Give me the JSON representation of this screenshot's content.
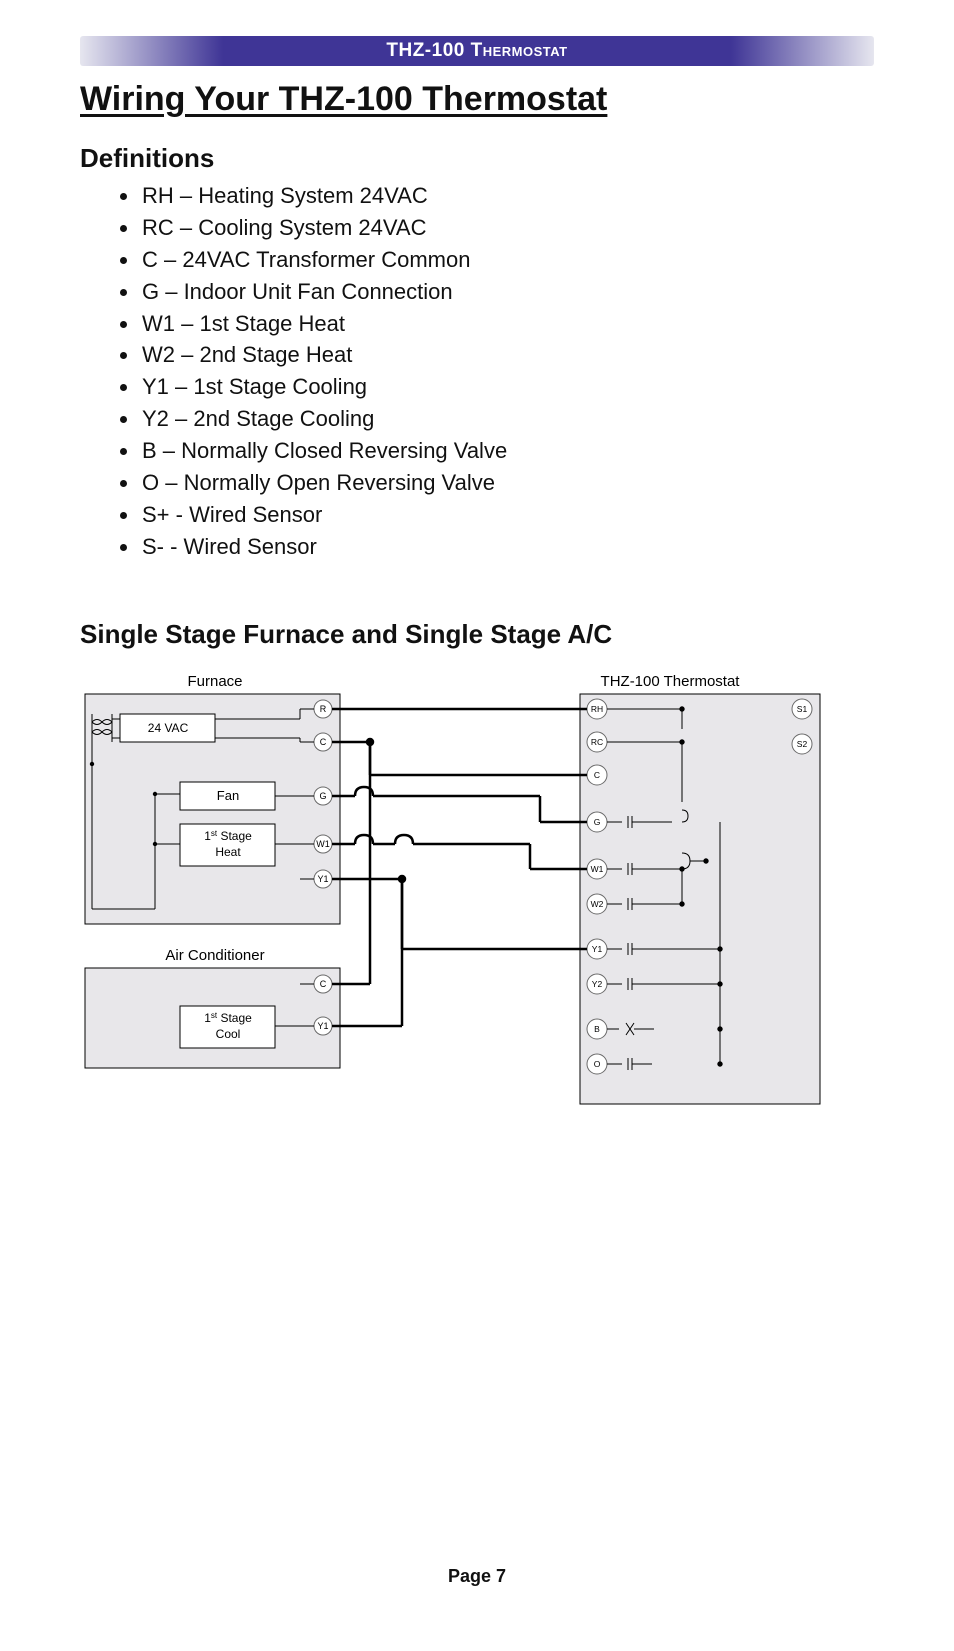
{
  "header": {
    "title": "THZ-100 Thermostat"
  },
  "main": {
    "title": "Wiring Your THZ-100 Thermostat",
    "definitions_heading": "Definitions",
    "definitions": [
      "RH – Heating System 24VAC",
      "RC – Cooling System 24VAC",
      "C – 24VAC Transformer Common",
      "G – Indoor Unit Fan Connection",
      "W1 – 1st Stage Heat",
      "W2 – 2nd Stage Heat",
      "Y1 – 1st Stage Cooling",
      "Y2 – 2nd Stage Cooling",
      "B – Normally Closed Reversing Valve",
      "O – Normally Open Reversing Valve",
      "S+ - Wired Sensor",
      "S- - Wired Sensor"
    ],
    "diagram_title": "Single Stage Furnace and Single Stage A/C",
    "diagram": {
      "left_top_label": "Furnace",
      "left_bottom_label": "Air Conditioner",
      "right_label": "THZ-100 Thermostat",
      "furnace": {
        "transformer": "24 VAC",
        "fan": "Fan",
        "heat_top": "1",
        "heat_sup": "st",
        "heat_suffix": " Stage",
        "heat_line2": "Heat",
        "terminals": [
          "R",
          "C",
          "G",
          "W1",
          "Y1"
        ]
      },
      "ac": {
        "cool_top": "1",
        "cool_sup": "st",
        "cool_suffix": " Stage",
        "cool_line2": "Cool",
        "terminals": [
          "C",
          "Y1"
        ]
      },
      "thermostat": {
        "left_terminals": [
          "RH",
          "RC",
          "C",
          "G",
          "W1",
          "W2",
          "Y1",
          "Y2",
          "B",
          "O"
        ],
        "right_terminals": [
          "S1",
          "S2"
        ]
      }
    }
  },
  "footer": {
    "page_label": "Page 7"
  }
}
